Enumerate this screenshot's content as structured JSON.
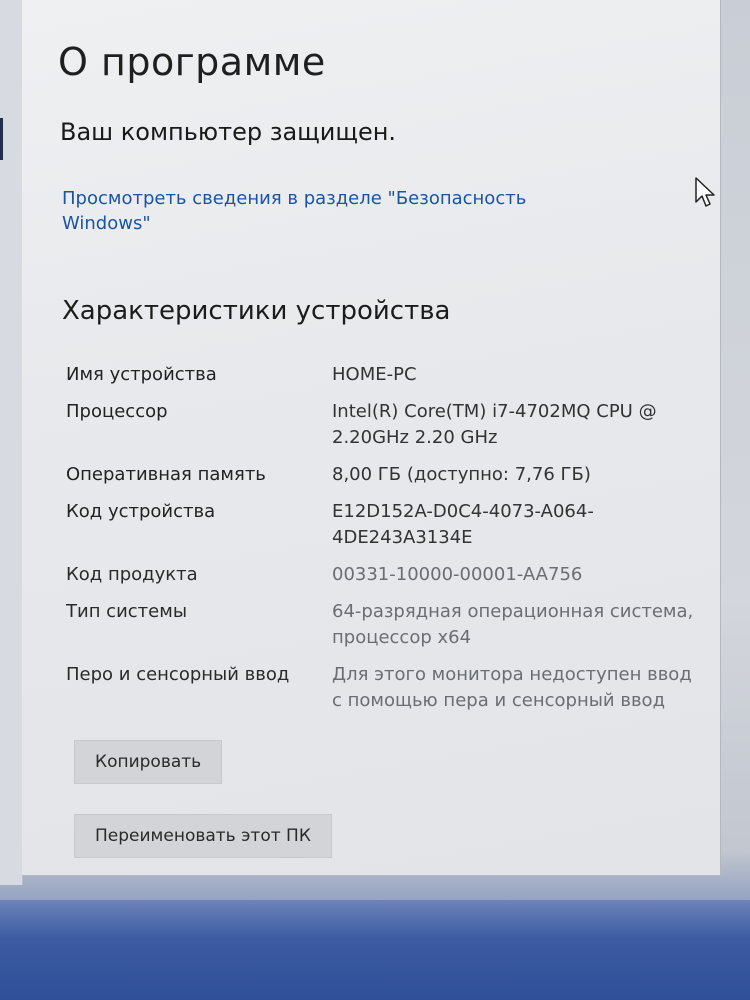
{
  "window": {
    "title": "О программе"
  },
  "security": {
    "status": "Ваш компьютер защищен.",
    "link": "Просмотреть сведения в разделе \"Безопасность Windows\""
  },
  "device_specs": {
    "heading": "Характеристики устройства",
    "rows": [
      {
        "label": "Имя устройства",
        "value": "HOME-PC"
      },
      {
        "label": "Процессор",
        "value": "Intel(R) Core(TM) i7-4702MQ CPU @ 2.20GHz   2.20 GHz"
      },
      {
        "label": "Оперативная память",
        "value": "8,00 ГБ (доступно: 7,76 ГБ)"
      },
      {
        "label": "Код устройства",
        "value": "E12D152A-D0C4-4073-A064-4DE243A3134E"
      },
      {
        "label": "Код продукта",
        "value": "00331-10000-00001-AA756"
      },
      {
        "label": "Тип системы",
        "value": "64-разрядная операционная система, процессор x64"
      },
      {
        "label": "Перо и сенсорный ввод",
        "value": "Для этого монитора недоступен ввод с помощью пера и сенсорный ввод"
      }
    ]
  },
  "buttons": {
    "copy": "Копировать",
    "rename": "Переименовать этот ПК"
  },
  "icons": {
    "cursor": "mouse-pointer-icon"
  }
}
